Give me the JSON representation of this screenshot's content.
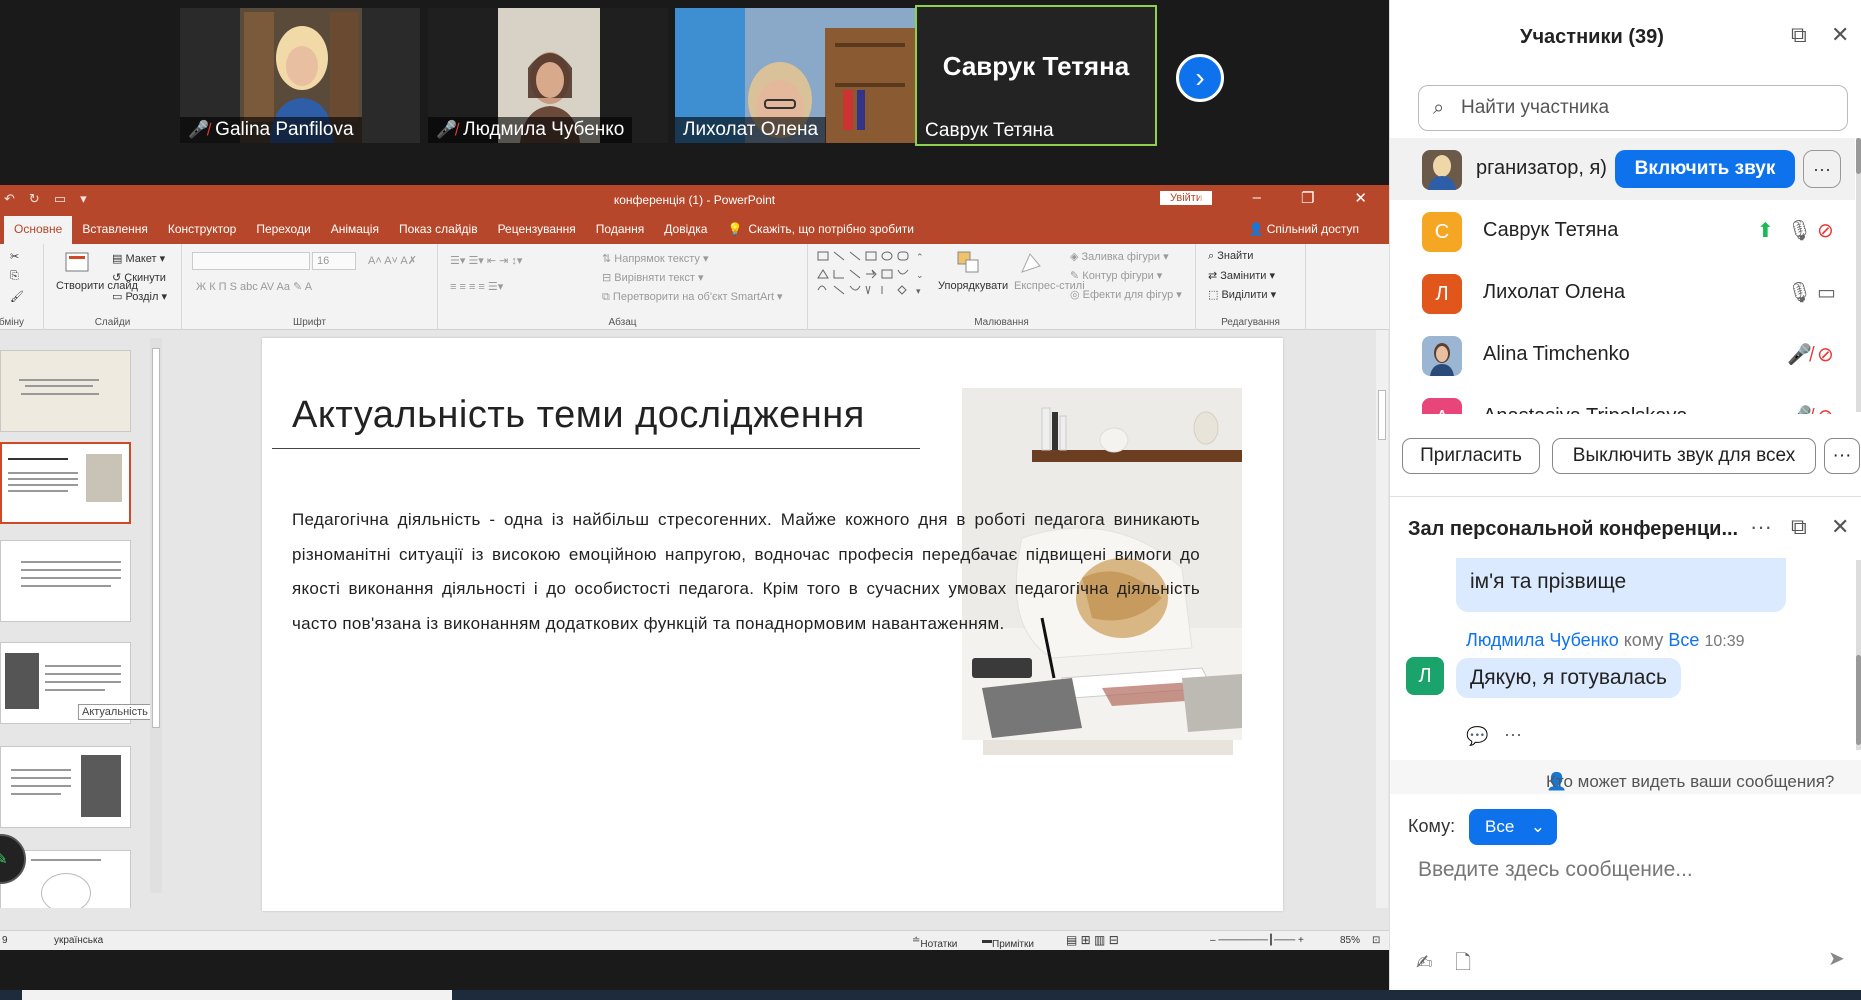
{
  "video": {
    "tiles": [
      {
        "name": "Galina Panfilova",
        "muted": true
      },
      {
        "name": "Людмила Чубенко",
        "muted": true
      },
      {
        "name": "Лихолат Олена",
        "muted": false
      },
      {
        "name": "Саврук Тетяна",
        "muted": false,
        "big_name": "Саврук Тетяна"
      }
    ],
    "next_icon": "chevron-right-icon"
  },
  "ppt": {
    "doc_title": "конференція (1)  -  PowerPoint",
    "login_label": "Увійти",
    "tabs": [
      "Основне",
      "Вставлення",
      "Конструктор",
      "Переходи",
      "Анімація",
      "Показ слайдів",
      "Рецензування",
      "Подання",
      "Довідка"
    ],
    "tell_me": "Скажіть, що потрібно зробити",
    "share": "Спільний доступ",
    "ribbon": {
      "clipboard_label": "Буфер обміну",
      "slides": {
        "new_slide": "Створити слайд",
        "layout": "Макет",
        "reset": "Скинути",
        "section": "Розділ",
        "label": "Слайди"
      },
      "font": {
        "name": "",
        "size": "16",
        "label": "Шрифт"
      },
      "paragraph": {
        "direction": "Напрямок тексту",
        "align": "Вирівняти текст",
        "smartart": "Перетворити на об'єкт SmartArt",
        "label": "Абзац"
      },
      "drawing": {
        "arrange": "Упорядкувати",
        "styles": "Експрес-стилі",
        "fill": "Заливка фігури",
        "outline": "Контур фігури",
        "effects": "Ефекти для фігур",
        "label": "Малювання"
      },
      "editing": {
        "find": "Знайти",
        "replace": "Замінити",
        "select": "Виділити",
        "label": "Редагування"
      }
    },
    "thumbs_tooltip": "Актуальність теми дослідження",
    "slide": {
      "title": "Актуальність теми дослідження",
      "body": "Педагогічна діяльність - одна із найбільш стресогенних. Майже кожного дня в роботі педагога виникають різноманітні ситуації із високою емоційною напругою, водночас професія передбачає підвищені вимоги до якості виконання діяльності і до особистості педагога. Крім того в сучасних умовах педагогічна діяльність часто пов'язана із виконанням додаткових функцій та понаднормовим навантаженням."
    },
    "status": {
      "slide_no": "9",
      "language": "українська",
      "notes": "Нотатки",
      "comments": "Примітки",
      "zoom": "85%"
    }
  },
  "panel": {
    "title": "Участники (39)",
    "search_placeholder": "Найти участника",
    "participants": [
      {
        "name": "рганизатор, я)",
        "initial": "",
        "color": "#6d8fb8",
        "unmute": "Включить звук"
      },
      {
        "name": "Саврук Тетяна",
        "initial": "С",
        "color": "#f5a623"
      },
      {
        "name": "Лихолат Олена",
        "initial": "Л",
        "color": "#e0561b"
      },
      {
        "name": "Alina Timchenko",
        "initial": "",
        "color": "#7a9cc2"
      },
      {
        "name": "Anastasiya Tripolskaya",
        "initial": "А",
        "color": "#e8457a"
      }
    ],
    "invite": "Пригласить",
    "mute_all": "Выключить звук для всех",
    "chat_title": "Зал персональной конференци...",
    "chat_bubble1": "ім'я та прізвище",
    "chat_sender": "Людмила Чубенко",
    "chat_to_word": "кому",
    "chat_to": "Все",
    "chat_time": "10:39",
    "chat_initial": "Л",
    "chat_bubble2": "Дякую, я готувалась",
    "who_sees": "Кто может видеть ваши сообщения?",
    "to_label": "Кому:",
    "to_value": "Все",
    "message_placeholder": "Введите здесь сообщение..."
  }
}
